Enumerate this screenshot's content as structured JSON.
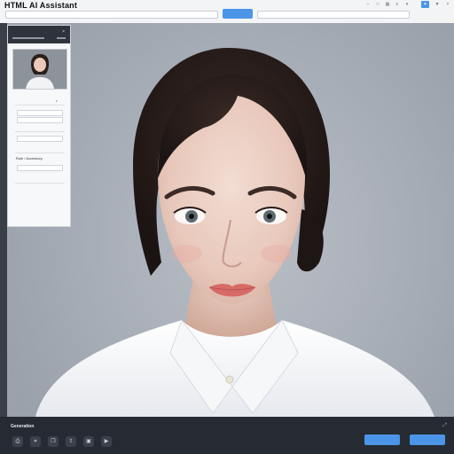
{
  "app": {
    "title": "HTML AI Assistant"
  },
  "toolbar": {
    "primary_button_label": "",
    "icons": [
      "minimize-icon",
      "maximize-icon",
      "grid-icon",
      "layers-icon",
      "chevron-down-icon",
      "settings-icon",
      "close-icon"
    ]
  },
  "panel": {
    "title": "",
    "close_glyph": "×",
    "rows": [
      {
        "label": ""
      },
      {
        "label": ""
      },
      {
        "label": ""
      },
      {
        "label": ""
      }
    ],
    "name_label": "Role / Accessory"
  },
  "bottom": {
    "title": "Generation",
    "expand_glyph": "⤢",
    "tools": [
      "camera-icon",
      "crop-icon",
      "copy-icon",
      "share-icon",
      "video-icon"
    ],
    "primary_action": "",
    "secondary_action": ""
  },
  "colors": {
    "accent": "#4b95e8",
    "dark_bar": "#262b33",
    "panel_header": "#2f343c",
    "background": "#a9afb8"
  }
}
